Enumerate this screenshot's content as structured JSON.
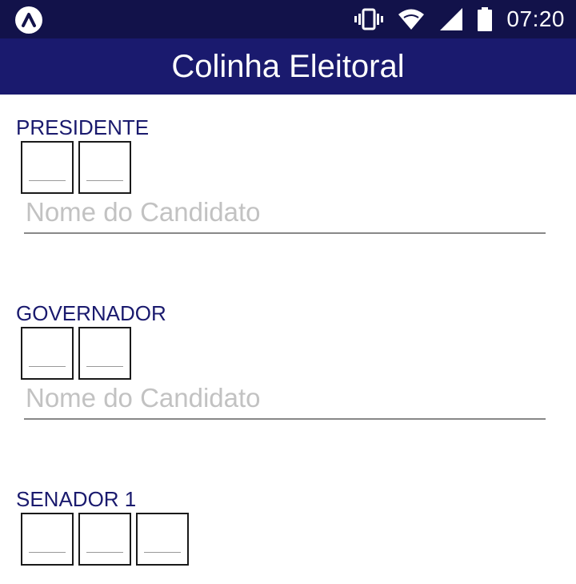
{
  "status_bar": {
    "time": "07:20",
    "icons": [
      "app-notification-icon",
      "vibrate-icon",
      "wifi-icon",
      "signal-icon",
      "battery-icon"
    ]
  },
  "app_bar": {
    "title": "Colinha Eleitoral"
  },
  "sections": [
    {
      "label": "PRESIDENTE",
      "digit_count": 2,
      "name_placeholder": "Nome do Candidato"
    },
    {
      "label": "GOVERNADOR",
      "digit_count": 2,
      "name_placeholder": "Nome do Candidato"
    },
    {
      "label": "SENADOR 1",
      "digit_count": 3
    }
  ],
  "colors": {
    "status_bar": "#12124a",
    "app_bar": "#1a1a6e",
    "label_text": "#1a1a6e"
  }
}
